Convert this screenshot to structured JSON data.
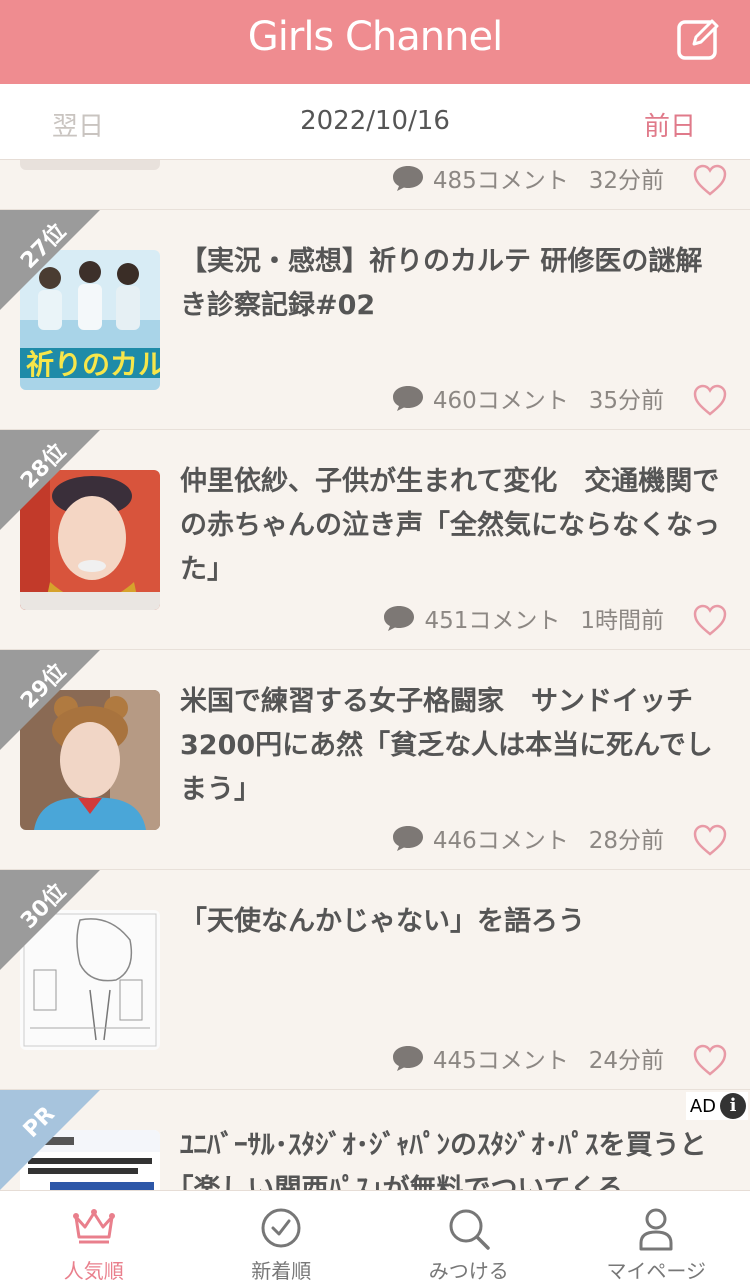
{
  "header": {
    "title": "Girls Channel",
    "compose_icon": "compose-icon"
  },
  "date_nav": {
    "next_label": "翌日",
    "date": "2022/10/16",
    "prev_label": "前日"
  },
  "partial_item": {
    "comments": "485コメント",
    "time": "32分前"
  },
  "items": [
    {
      "rank": "27位",
      "title": "【実況・感想】祈りのカルテ 研修医の謎解き診察記録#02",
      "comments": "460コメント",
      "time": "35分前"
    },
    {
      "rank": "28位",
      "title": "仲里依紗、子供が生まれて変化　交通機関での赤ちゃんの泣き声「全然気にならなくなった」",
      "comments": "451コメント",
      "time": "1時間前"
    },
    {
      "rank": "29位",
      "title": "米国で練習する女子格闘家　サンドイッチ3200円にあ然「貧乏な人は本当に死んでしまう」",
      "comments": "446コメント",
      "time": "28分前"
    },
    {
      "rank": "30位",
      "title": "「天使なんかじゃない」を語ろう",
      "comments": "445コメント",
      "time": "24分前"
    }
  ],
  "ad_item": {
    "badge": "PR",
    "ad_label": "AD",
    "info_symbol": "i",
    "title": "ﾕﾆﾊﾞｰｻﾙ･ｽﾀｼﾞｵ･ｼﾞｬﾊﾟﾝのｽﾀｼﾞｵ･ﾊﾟｽを買うと｢楽しい関西ﾊﾟｽ｣が無料でついてくる"
  },
  "tabs": [
    {
      "label": "人気順",
      "icon": "crown-icon",
      "active": true
    },
    {
      "label": "新着順",
      "icon": "clock-icon",
      "active": false
    },
    {
      "label": "みつける",
      "icon": "search-icon",
      "active": false
    },
    {
      "label": "マイページ",
      "icon": "person-icon",
      "active": false
    }
  ],
  "colors": {
    "brand": "#ef8c90",
    "accent": "#e97f8c",
    "rank_ribbon": "#9b9b9b",
    "pr_ribbon": "#a7c4dd",
    "background": "#f8f3ee"
  }
}
